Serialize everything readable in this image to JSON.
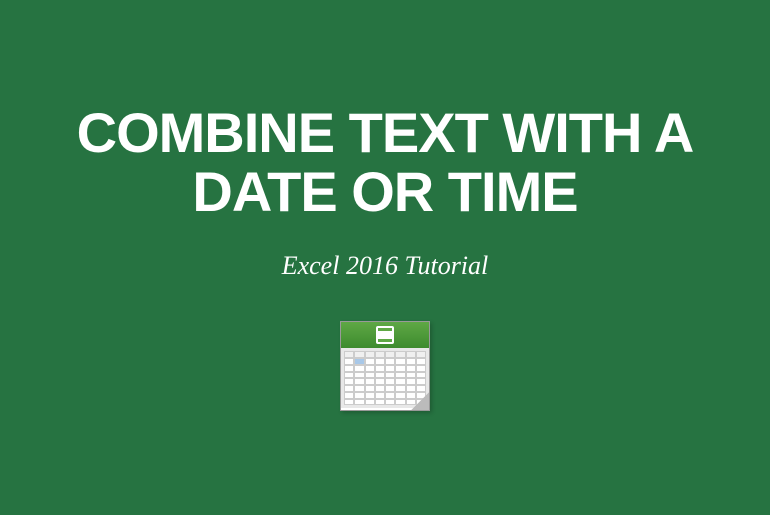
{
  "title": "COMBINE TEXT WITH A DATE OR TIME",
  "subtitle": "Excel 2016 Tutorial"
}
